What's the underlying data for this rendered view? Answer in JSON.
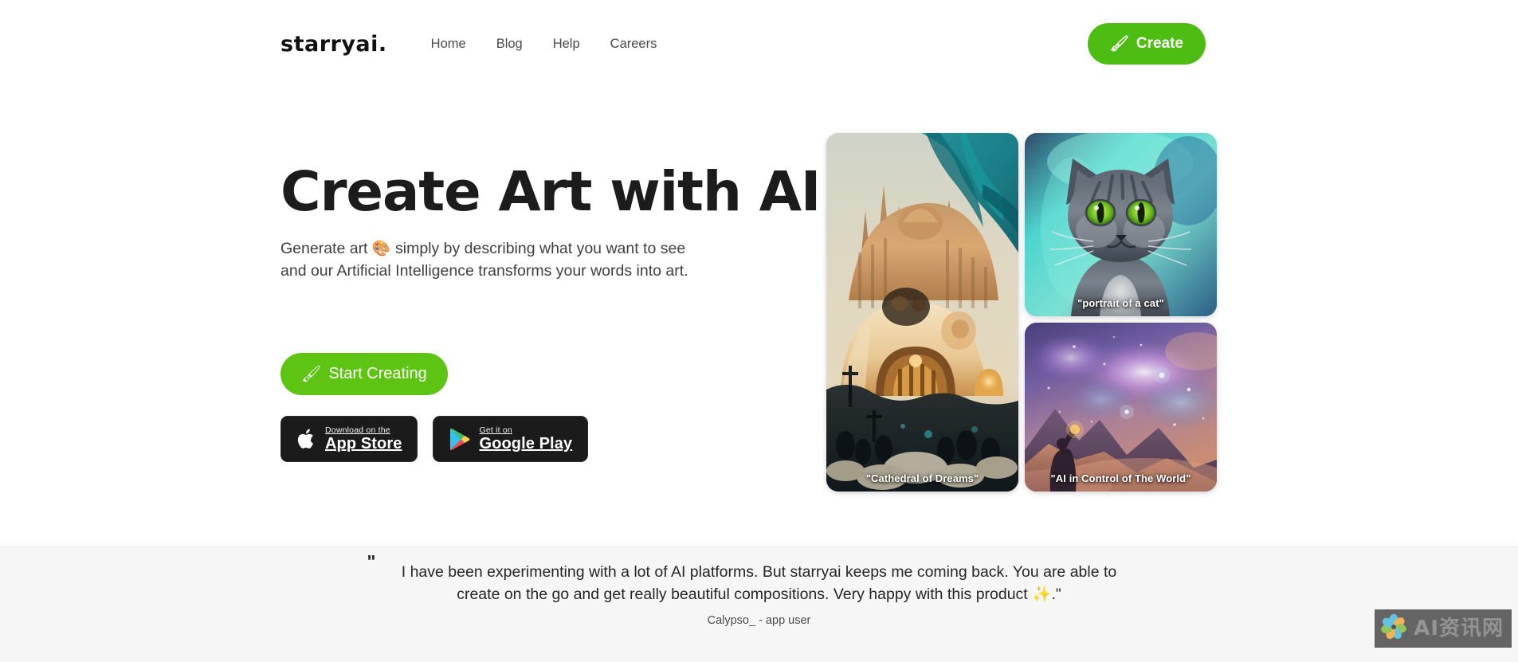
{
  "header": {
    "logo": "starryai",
    "logo_dot": ".",
    "nav": [
      {
        "label": "Home",
        "active": true
      },
      {
        "label": "Blog",
        "active": false
      },
      {
        "label": "Help",
        "active": false
      },
      {
        "label": "Careers",
        "active": false
      }
    ],
    "create_button": {
      "label": "Create",
      "emoji": "🖌",
      "color": "#4dbd14"
    }
  },
  "hero": {
    "headline": "Create Art with AI",
    "subhead_line1_pre": "Generate art ",
    "subhead_emoji": "🎨",
    "subhead_line1_post": " simply by describing what you want to see",
    "subhead_line2": "and our Artificial Intelligence transforms your words into art.",
    "subhead_full": "Generate art 🎨 simply by describing what you want to see and our Artificial Intelligence transforms your words into art.",
    "start_button": {
      "label": "Start Creating",
      "emoji": "🖌",
      "color": "#5ec413"
    },
    "stores": [
      {
        "small": "Download on the",
        "big": "App Store",
        "icon": "apple-icon"
      },
      {
        "small": "Get it on",
        "big": "Google Play",
        "icon": "google-play-icon"
      }
    ]
  },
  "gallery": {
    "items": [
      {
        "caption": "\"Cathedral of Dreams\"",
        "name": "art-card-cathedral"
      },
      {
        "caption": "\"portrait of a cat\"",
        "name": "art-card-cat"
      },
      {
        "caption": "\"AI in Control of The World\"",
        "name": "art-card-world"
      }
    ]
  },
  "testimonial": {
    "quote_mark": "\"",
    "line1": "I have been experimenting with a lot of AI platforms. But starryai keeps me coming back. You are able to",
    "line2_pre": "create on the go and get really beautiful compositions. Very happy with this product ",
    "line2_emoji": "✨",
    "line2_post": ".\"",
    "author": "Calypso_ - app user"
  },
  "watermark": {
    "text": "AI资讯网"
  }
}
